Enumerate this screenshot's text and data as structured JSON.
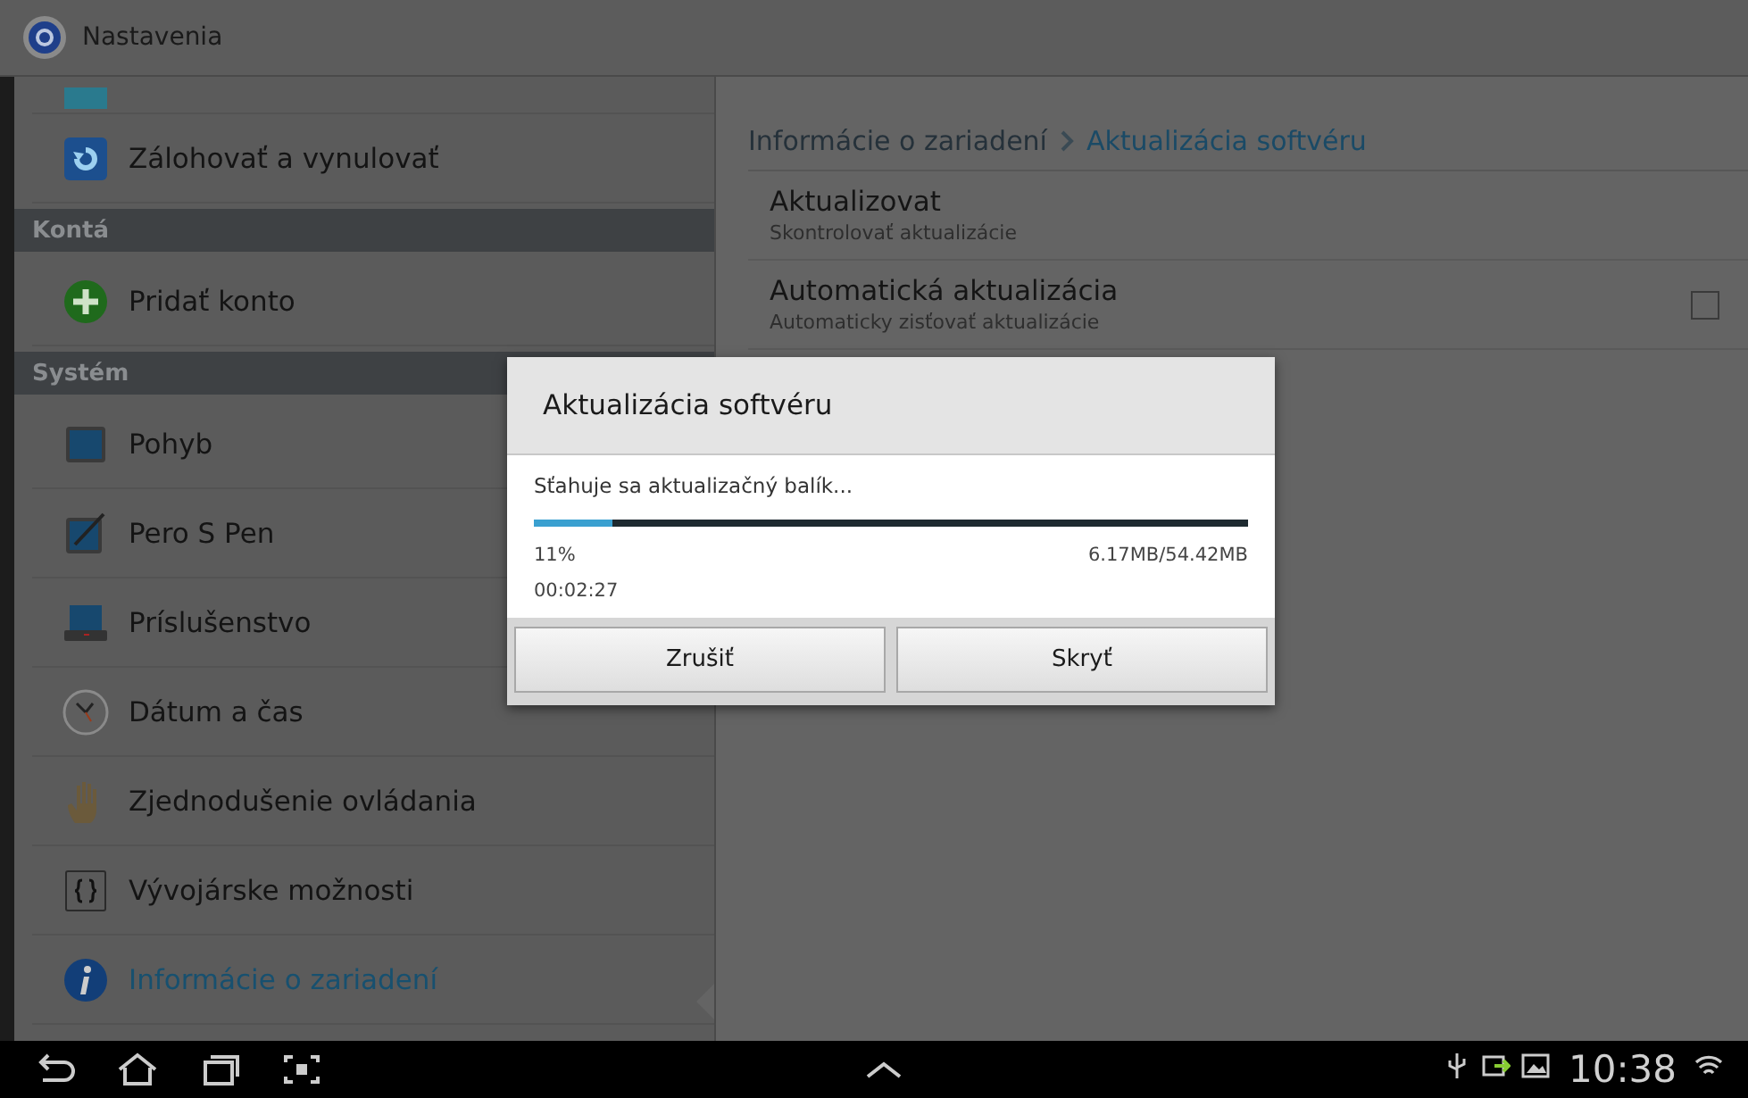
{
  "action_bar": {
    "title": "Nastavenia"
  },
  "sidebar": {
    "items": [
      {
        "kind": "item",
        "label": "Zálohovať a vynulovať",
        "selected": false
      },
      {
        "kind": "header",
        "label": "Kontá"
      },
      {
        "kind": "item",
        "label": "Pridať konto",
        "selected": false
      },
      {
        "kind": "header",
        "label": "Systém"
      },
      {
        "kind": "item",
        "label": "Pohyb",
        "selected": false
      },
      {
        "kind": "item",
        "label": "Pero S Pen",
        "selected": false
      },
      {
        "kind": "item",
        "label": "Príslušenstvo",
        "selected": false
      },
      {
        "kind": "item",
        "label": "Dátum a čas",
        "selected": false
      },
      {
        "kind": "item",
        "label": "Zjednodušenie ovládania",
        "selected": false
      },
      {
        "kind": "item",
        "label": "Vývojárske možnosti",
        "selected": false
      },
      {
        "kind": "item",
        "label": "Informácie o zariadení",
        "selected": true
      }
    ]
  },
  "breadcrumb": {
    "parent": "Informácie o zariadení",
    "current": "Aktualizácia softvéru"
  },
  "settings": [
    {
      "title": "Aktualizovat",
      "summary": "Skontrolovať aktualizácie"
    },
    {
      "title": "Automatická aktualizácia",
      "summary": "Automaticky zisťovať aktualizácie",
      "checked": false
    }
  ],
  "dialog": {
    "title": "Aktualizácia softvéru",
    "message": "Sťahuje sa aktualizačný balík...",
    "level": 0.11,
    "percent": "11%",
    "size": "6.17MB/54.42MB",
    "elapsed": "00:02:27",
    "buttons": [
      "Zrušiť",
      "Skryť"
    ]
  },
  "status_bar": {
    "time": "10:38"
  }
}
